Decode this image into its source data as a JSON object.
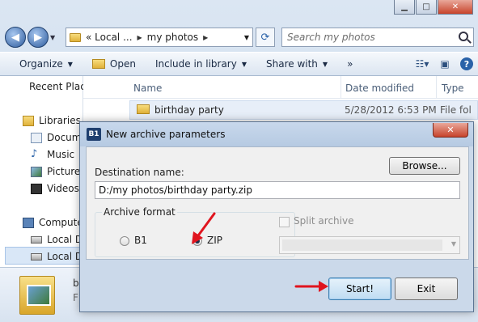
{
  "explorer": {
    "address_parts": [
      "« Local ...",
      "my photos"
    ],
    "search_placeholder": "Search my photos",
    "toolbar": {
      "organize": "Organize",
      "open": "Open",
      "include": "Include in library",
      "share": "Share with",
      "more": "»"
    },
    "nav_pane": [
      {
        "label": "Recent Places",
        "icon": "recent-places-icon"
      },
      {
        "label": "Libraries",
        "icon": "libraries-icon"
      },
      {
        "label": "Docum",
        "icon": "documents-icon"
      },
      {
        "label": "Music",
        "icon": "music-icon"
      },
      {
        "label": "Pictures",
        "icon": "pictures-icon"
      },
      {
        "label": "Videos",
        "icon": "videos-icon"
      },
      {
        "label": "Compute",
        "icon": "computer-icon"
      },
      {
        "label": "Local D",
        "icon": "local-disk-icon"
      },
      {
        "label": "Local D",
        "icon": "local-disk-icon"
      }
    ],
    "columns": {
      "name": "Name",
      "date_modified": "Date modified",
      "type": "Type"
    },
    "files": [
      {
        "name": "birthday party",
        "date": "5/28/2012 6:53 PM",
        "type": "File fol"
      }
    ],
    "details": {
      "name": "b",
      "type": "F"
    }
  },
  "dialog": {
    "title": "New archive parameters",
    "icon_text": "B1",
    "close_label": "✕",
    "destination_label": "Destination name:",
    "browse_label": "Browse...",
    "destination_value": "D:/my photos/birthday party.zip",
    "archive_format_label": "Archive format",
    "format_options": [
      {
        "label": "B1",
        "checked": false
      },
      {
        "label": "ZIP",
        "checked": true
      }
    ],
    "split_label": "Split archive",
    "split_checked": false,
    "start_label": "Start!",
    "exit_label": "Exit"
  },
  "colors": {
    "annotation_arrow": "#e0141e",
    "close_button": "#c7432b",
    "start_button_border": "#3c7fb1"
  }
}
